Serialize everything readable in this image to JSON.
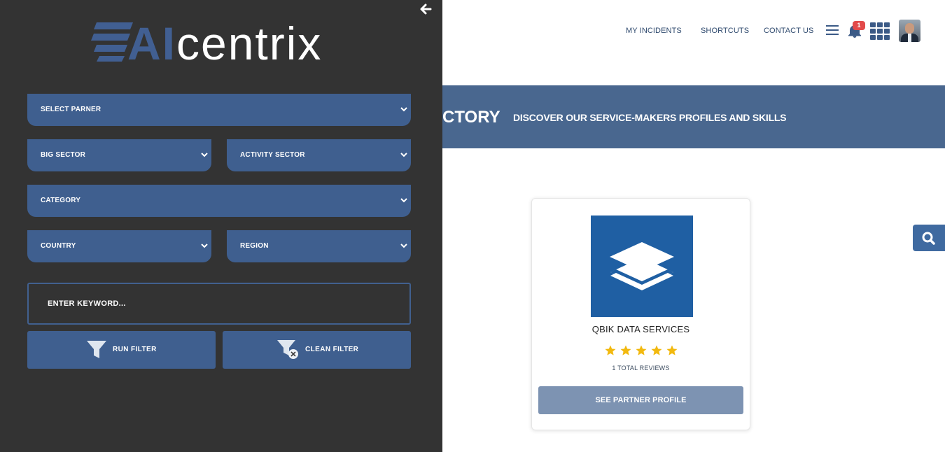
{
  "nav": {
    "links": [
      "MY INCIDENTS",
      "SHORTCUTS",
      "CONTACT US"
    ],
    "notification_count": "1"
  },
  "banner": {
    "title_partial": "CTORY",
    "subtitle": "DISCOVER OUR SERVICE-MAKERS PROFILES AND SKILLS"
  },
  "panel": {
    "logo_ai": "AI",
    "logo_rest": "centrix",
    "selects": {
      "partner": "SELECT PARNER",
      "big_sector": "BIG SECTOR",
      "activity_sector": "ACTIVITY SECTOR",
      "category": "CATEGORY",
      "country": "COUNTRY",
      "region": "REGION"
    },
    "keyword_placeholder": "ENTER KEYWORD...",
    "run_filter": "RUN FILTER",
    "clean_filter": "CLEAN FILTER"
  },
  "card": {
    "name": "QBIK DATA SERVICES",
    "rating": 5,
    "rating_max": 5,
    "reviews": "1 TOTAL REVIEWS",
    "button": "SEE PARTNER PROFILE"
  },
  "colors": {
    "panel_bg": "#333333",
    "control_blue": "#3f5f8f",
    "banner_blue": "#49678f",
    "logo_blue": "#1f5fa3",
    "star": "#f2b90f",
    "badge_red": "#e24a4a"
  }
}
